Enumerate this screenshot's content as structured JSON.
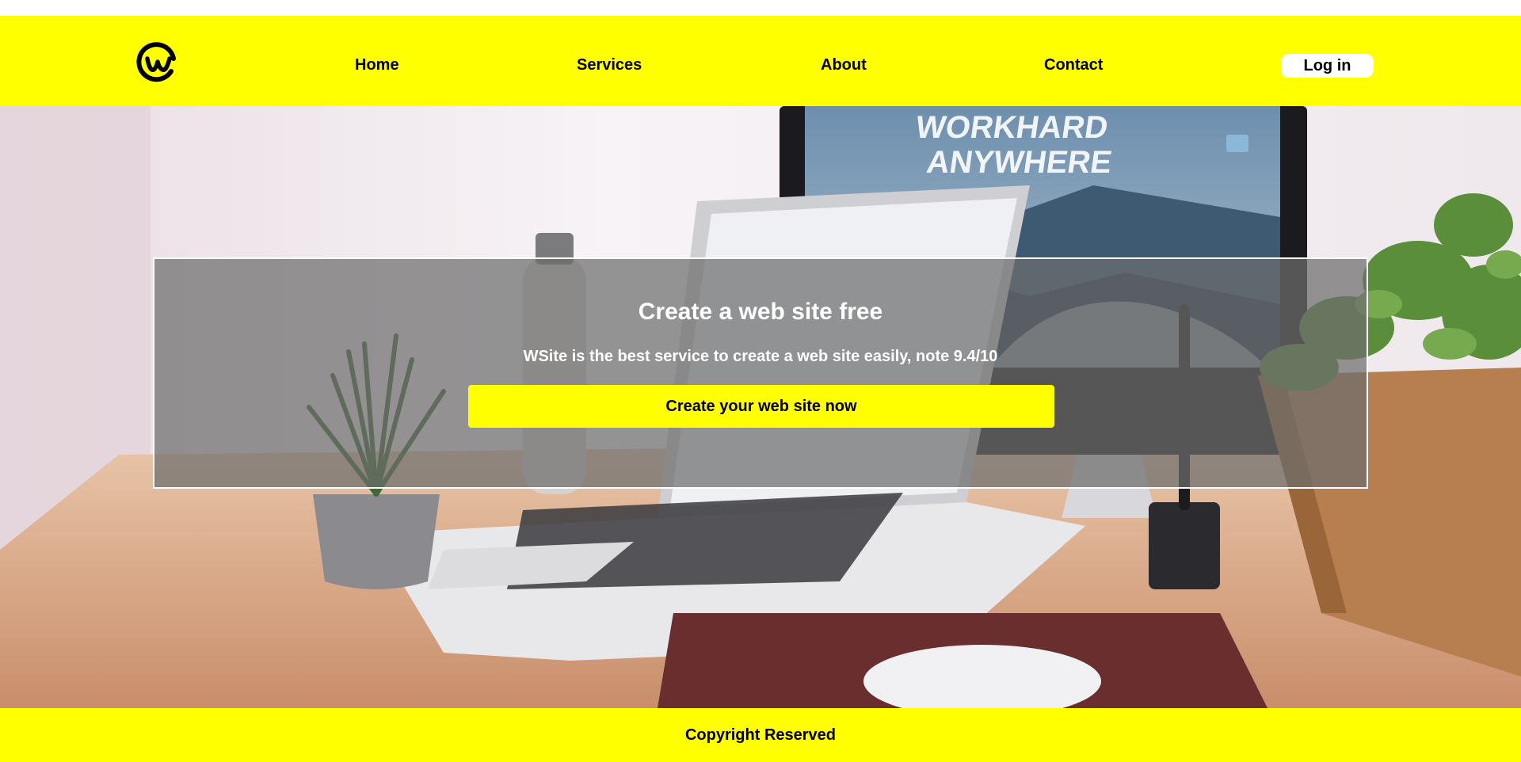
{
  "brand": {
    "logo_icon": "workplace-logo-icon",
    "accent_color": "#ffff00"
  },
  "nav": {
    "items": [
      {
        "label": "Home"
      },
      {
        "label": "Services"
      },
      {
        "label": "About"
      },
      {
        "label": "Contact"
      }
    ],
    "login_label": "Log in"
  },
  "hero": {
    "background_image_text": {
      "headline_line1": "WORKHARD",
      "headline_line2": "ANYWHERE"
    },
    "title": "Create a web site free",
    "subtitle": "WSite is the best service to create a web site easily, note 9.4/10",
    "cta_label": "Create your web site now"
  },
  "footer": {
    "text": "Copyright Reserved"
  }
}
